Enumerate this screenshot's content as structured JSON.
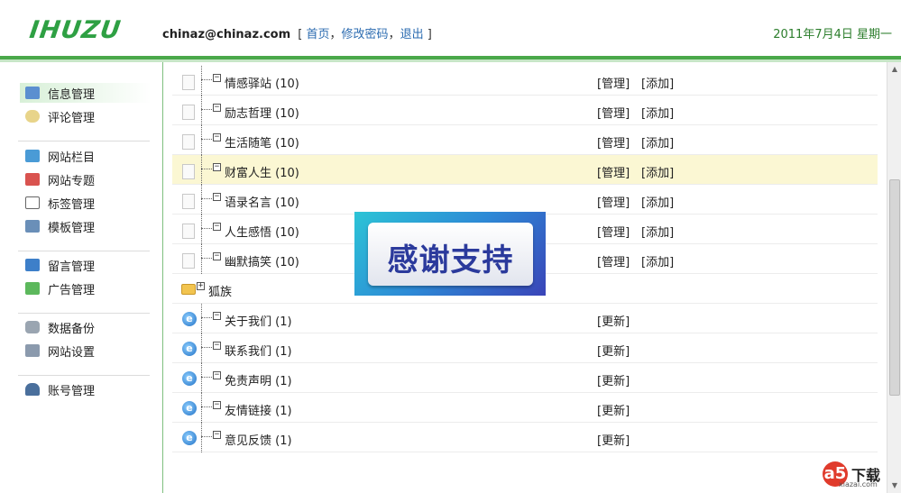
{
  "header": {
    "logo": "IHUZU",
    "email": "chinaz@chinaz.com",
    "bracket_open": "[",
    "links": [
      "首页",
      "修改密码",
      "退出"
    ],
    "sep": "，",
    "bracket_close": "]",
    "date": "2011年7月4日 星期一"
  },
  "sidebar": {
    "groups": [
      [
        {
          "label": "信息管理",
          "icon": "monitor-icon"
        },
        {
          "label": "评论管理",
          "icon": "comment-icon"
        }
      ],
      [
        {
          "label": "网站栏目",
          "icon": "folder-window-icon"
        },
        {
          "label": "网站专题",
          "icon": "topic-icon"
        },
        {
          "label": "标签管理",
          "icon": "tag-window-icon"
        },
        {
          "label": "模板管理",
          "icon": "template-icon"
        }
      ],
      [
        {
          "label": "留言管理",
          "icon": "message-icon"
        },
        {
          "label": "广告管理",
          "icon": "ad-icon"
        }
      ],
      [
        {
          "label": "数据备份",
          "icon": "database-icon"
        },
        {
          "label": "网站设置",
          "icon": "tools-icon"
        }
      ],
      [
        {
          "label": "账号管理",
          "icon": "users-icon"
        }
      ]
    ]
  },
  "list": {
    "rows": [
      {
        "name": "情感驿站 (10)",
        "a1": "[管理]",
        "a2": "[添加]"
      },
      {
        "name": "励志哲理 (10)",
        "a1": "[管理]",
        "a2": "[添加]"
      },
      {
        "name": "生活随笔 (10)",
        "a1": "[管理]",
        "a2": "[添加]"
      },
      {
        "name": "财富人生 (10)",
        "a1": "[管理]",
        "a2": "[添加]"
      },
      {
        "name": "语录名言 (10)",
        "a1": "[管理]",
        "a2": "[添加]"
      },
      {
        "name": "人生感悟 (10)",
        "a1": "[管理]",
        "a2": "[添加]"
      },
      {
        "name": "幽默搞笑 (10)",
        "a1": "[管理]",
        "a2": "[添加]"
      },
      {
        "name": "狐族"
      },
      {
        "name": "关于我们 (1)",
        "a1": "[更新]"
      },
      {
        "name": "联系我们 (1)",
        "a1": "[更新]"
      },
      {
        "name": "免责声明 (1)",
        "a1": "[更新]"
      },
      {
        "name": "友情链接 (1)",
        "a1": "[更新]"
      },
      {
        "name": "意见反馈 (1)",
        "a1": "[更新]"
      }
    ]
  },
  "watermark": {
    "text": "感谢支持"
  },
  "badge": {
    "letter": "a5",
    "text": "下载",
    "url": "xiazai.com"
  },
  "colors": {
    "accent": "#4aa84a",
    "link": "#2b6bb0",
    "highlight_row": "#fbf7d3"
  }
}
